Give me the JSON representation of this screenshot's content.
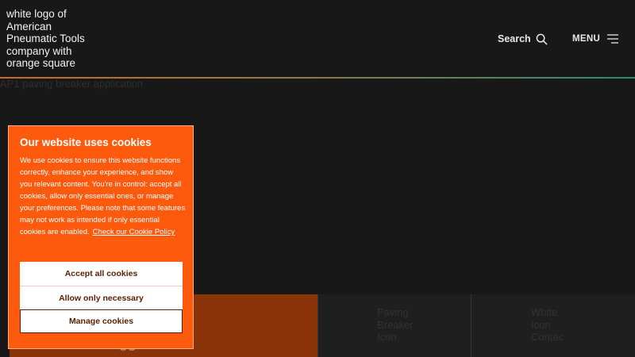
{
  "header": {
    "logo_alt": "white logo of American Pneumatic Tools company with orange square",
    "search_label": "Search",
    "menu_label": "MENU"
  },
  "hero": {
    "image_alt": "AP1 paving breaker application"
  },
  "tiles": {
    "orange_partial_text": "gged",
    "paving_label": "Paving Breaker Icon",
    "contact_label": "White Icon Contac"
  },
  "cookie": {
    "title": "Our website uses cookies",
    "body": "We use cookies to ensure this website functions correctly, enhance your experience, and show you relevant content. You're in control: accept all cookies, allow only essential ones, or manage your preferences. Please note that some features may not work as intended if only essential cookies are enabled.",
    "policy_link": "Check our Cookie Policy",
    "accept_label": "Accept all cookies",
    "necessary_label": "Allow only necessary",
    "manage_label": "Manage cookies"
  },
  "colors": {
    "background": "#181818",
    "cookie_orange": "#fe5a0e",
    "tile_orange": "#8a3208",
    "button_text": "#5a1f00"
  },
  "icons": [
    "search-icon",
    "menu-icon"
  ]
}
